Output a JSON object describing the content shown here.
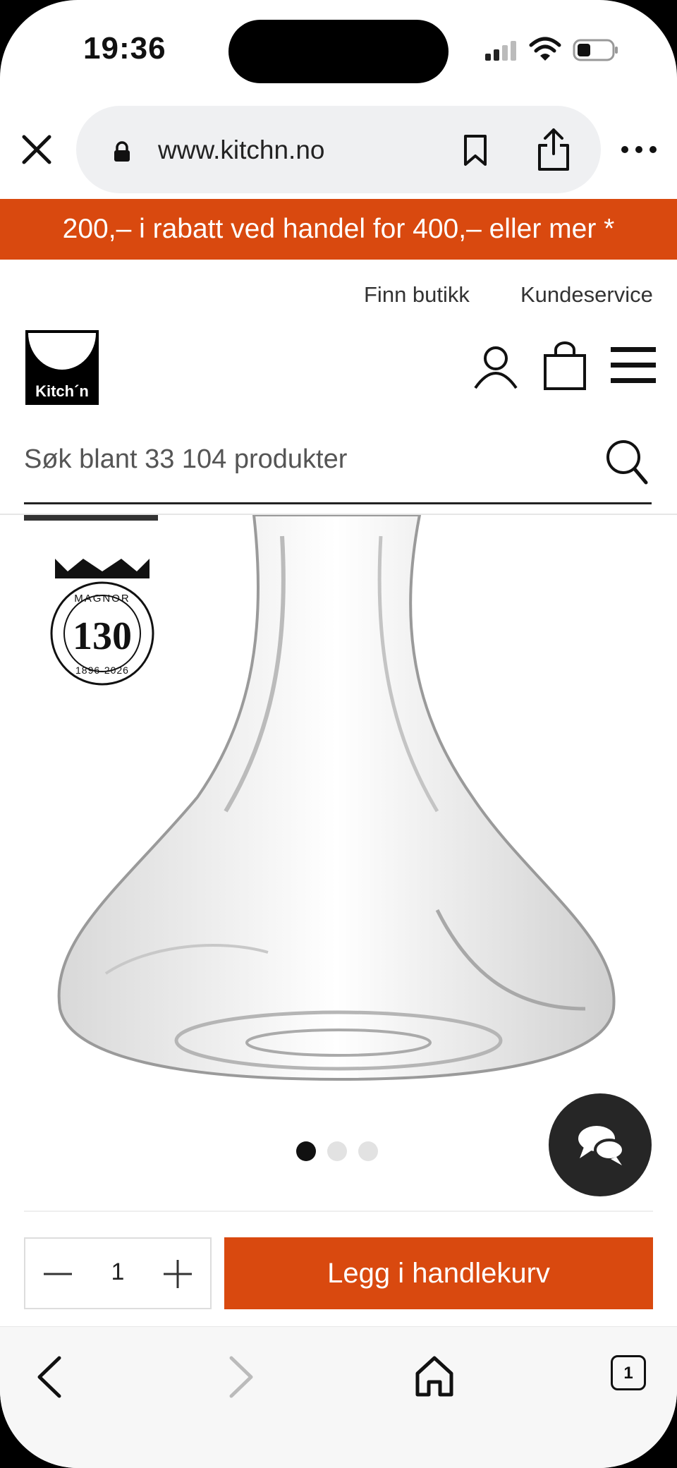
{
  "status_bar": {
    "time": "19:36"
  },
  "browser": {
    "url": "www.kitchn.no",
    "tab_count": "1"
  },
  "promo": {
    "text": "200,– i rabatt ved handel for 400,– eller mer *"
  },
  "top_links": {
    "find_store": "Finn butikk",
    "customer_service": "Kundeservice"
  },
  "header": {
    "logo_text": "Kitch´n"
  },
  "search": {
    "placeholder": "Søk blant 33 104 produkter"
  },
  "product": {
    "badge": {
      "top_text": "MAGNOR",
      "number": "130",
      "years": "1896-2026"
    },
    "gallery_dots": 3,
    "active_dot": 0
  },
  "cart": {
    "quantity": "1",
    "add_label": "Legg i handlekurv"
  },
  "colors": {
    "accent": "#d9490f",
    "chat_button": "#262626"
  }
}
